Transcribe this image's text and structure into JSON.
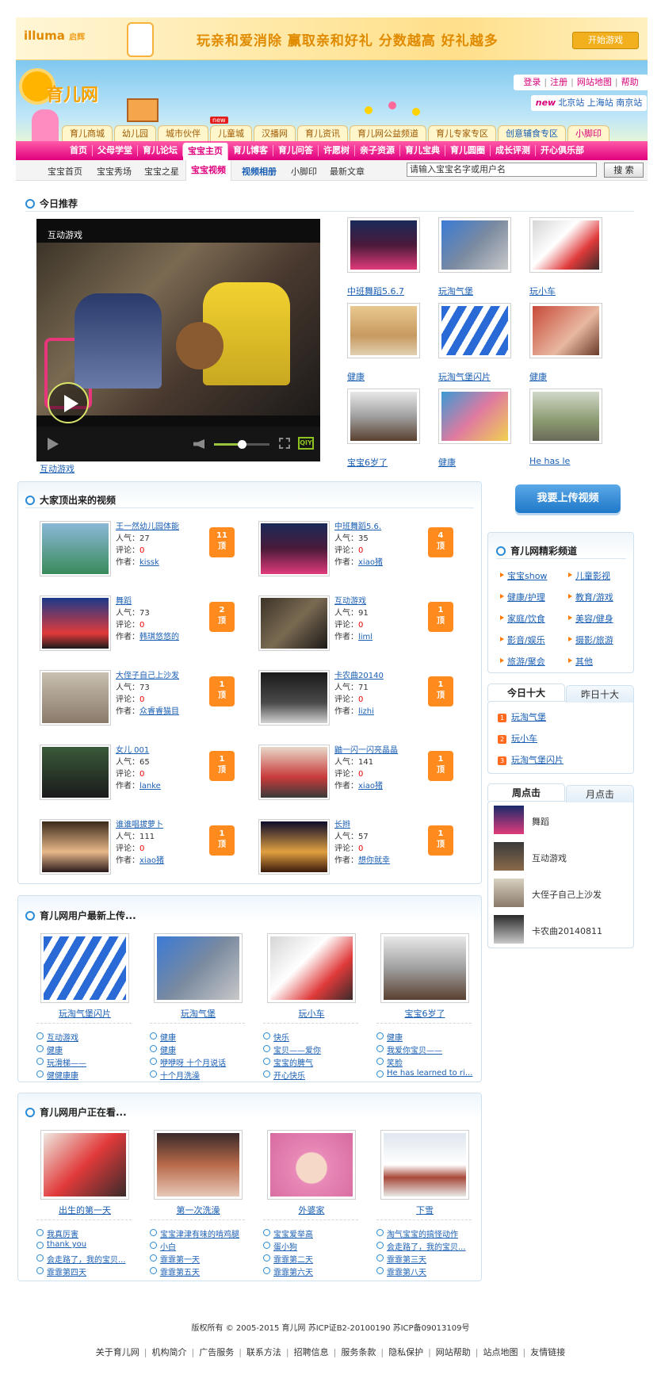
{
  "banner": {
    "logo": "illuma",
    "logo_sub": "启辉",
    "slogan": "玩亲和爱消除  赢取亲和好礼  分数越高  好礼越多",
    "play_button": "开始游戏"
  },
  "header": {
    "site_title": "育儿网",
    "top_links": [
      "登录",
      "注册",
      "网站地图",
      "帮助"
    ],
    "new_label": "new",
    "cities": [
      "北京站",
      "上海站",
      "南京站"
    ],
    "new_badge": "new"
  },
  "tabs": [
    "育儿商城",
    "幼儿园",
    "城市伙伴",
    "儿童城",
    "汉播网",
    "育儿资讯",
    "育儿网公益频道",
    "育儿专家专区",
    "创意辅食专区",
    "小脚印"
  ],
  "nav": [
    "首页",
    "父母学堂",
    "育儿论坛",
    "宝宝主页",
    "育儿博客",
    "育儿问答",
    "许愿树",
    "亲子资源",
    "育儿宝典",
    "育儿圆圈",
    "成长评测",
    "开心俱乐部"
  ],
  "subnav": [
    "宝宝首页",
    "宝宝秀场",
    "宝宝之星",
    "宝宝视频",
    "视频相册",
    "小脚印",
    "最新文章"
  ],
  "search": {
    "value": "请输入宝宝名字或用户名",
    "button": "搜 索"
  },
  "today": {
    "heading": "今日推荐",
    "player_title": "互动游戏",
    "player_caption": "互动游戏",
    "progress": 0.5,
    "thumbs": [
      "中班舞蹈5.6.7",
      "玩淘气堡",
      "玩小车",
      "健康",
      "玩淘气堡闪片",
      "健康",
      "宝宝6岁了",
      "健康",
      "He has le"
    ]
  },
  "everyone": {
    "heading": "大家顶出来的视频",
    "field_pop": "人气：",
    "field_comment": "评论：",
    "field_author": "作者：",
    "items": [
      {
        "title": "王一然幼儿园体能",
        "pop": "27",
        "comments": "0",
        "author": "kissk",
        "votes": "11",
        "unit": "顶"
      },
      {
        "title": "中班舞蹈5.6.",
        "pop": "35",
        "comments": "0",
        "author": "xiao猪",
        "votes": "4",
        "unit": "顶"
      },
      {
        "title": "舞蹈",
        "pop": "73",
        "comments": "0",
        "author": "韩琪悠悠的",
        "votes": "2",
        "unit": "顶"
      },
      {
        "title": "互动游戏",
        "pop": "91",
        "comments": "0",
        "author": "liml",
        "votes": "1",
        "unit": "顶"
      },
      {
        "title": "大侄子自己上沙发",
        "pop": "73",
        "comments": "0",
        "author": "众睿睿猫目",
        "votes": "1",
        "unit": "顶"
      },
      {
        "title": "卡农曲20140",
        "pop": "71",
        "comments": "0",
        "author": "lizhi",
        "votes": "1",
        "unit": "顶"
      },
      {
        "title": "女儿 001",
        "pop": "65",
        "comments": "0",
        "author": "lanke",
        "votes": "1",
        "unit": "顶"
      },
      {
        "title": "鼬一闪一闪亮晶晶",
        "pop": "141",
        "comments": "0",
        "author": "xiao猪",
        "votes": "1",
        "unit": "顶"
      },
      {
        "title": "谁谁唱拔萝卜",
        "pop": "111",
        "comments": "0",
        "author": "xiao猪",
        "votes": "1",
        "unit": "顶"
      },
      {
        "title": "长辫",
        "pop": "57",
        "comments": "0",
        "author": "想你就幸",
        "votes": "1",
        "unit": "顶"
      }
    ]
  },
  "sidebar": {
    "upload_button": "我要上传视频",
    "channels_heading": "育儿网精彩频道",
    "channels": [
      "宝宝show",
      "儿童影视",
      "健康/护理",
      "教育/游戏",
      "家庭/饮食",
      "美容/健身",
      "影音/娱乐",
      "摄影/旅游",
      "旅游/聚会",
      "其他"
    ],
    "top10_tabs": [
      "今日十大",
      "昨日十大"
    ],
    "top10": [
      "玩淘气堡",
      "玩小车",
      "玩淘气堡闪片"
    ],
    "rank_nums": [
      "1",
      "2",
      "3"
    ],
    "weekly_tabs": [
      "周点击",
      "月点击"
    ],
    "weekly": [
      "舞蹈",
      "互动游戏",
      "大侄子自己上沙发",
      "卡农曲20140811"
    ]
  },
  "latest": {
    "heading": "育儿网用户最新上传...",
    "thumbs": [
      "玩淘气堡闪片",
      "玩淘气堡",
      "玩小车",
      "宝宝6岁了"
    ],
    "links": [
      [
        "互动游戏",
        "健康",
        "玩滑梯——",
        "健健康康"
      ],
      [
        "健康",
        "健康",
        "咿咿呀 十个月说话",
        "十个月洗澡"
      ],
      [
        "快乐",
        "宝贝——爱你",
        "宝宝的脾气",
        "开心快乐"
      ],
      [
        "健康",
        "我爱你宝贝——",
        "笑脸",
        "He has learned to ri..."
      ]
    ]
  },
  "watching": {
    "heading": "育儿网用户正在看...",
    "thumbs": [
      "出生的第一天",
      "第一次洗澡",
      "外婆家",
      "下雪"
    ],
    "links": [
      [
        "我真厉害",
        "thank you",
        "会走路了，我的宝贝...",
        "霏霏第四天"
      ],
      [
        "宝宝津津有味的啃鸡腿",
        "小白",
        "霏霏第一天",
        "霏霏第五天"
      ],
      [
        "宝宝爱举高",
        "蛋小狗",
        "霏霏第二天",
        "霏霏第六天"
      ],
      [
        "淘气宝宝的搞怪动作",
        "会走路了，我的宝贝...",
        "霏霏第三天",
        "霏霏第八天"
      ]
    ]
  },
  "footer": {
    "copyright": "版权所有 © 2005-2015 育儿网  苏ICP证B2-20100190 苏ICP备09013109号",
    "links": [
      "关于育儿网",
      "机构简介",
      "广告服务",
      "联系方法",
      "招聘信息",
      "服务条款",
      "隐私保护",
      "网站帮助",
      "站点地图",
      "友情链接"
    ]
  },
  "colors": {
    "accent": "#e0007e",
    "link": "#1a5fb4",
    "vote": "#ff8a1e",
    "brand": "#f6a300"
  }
}
